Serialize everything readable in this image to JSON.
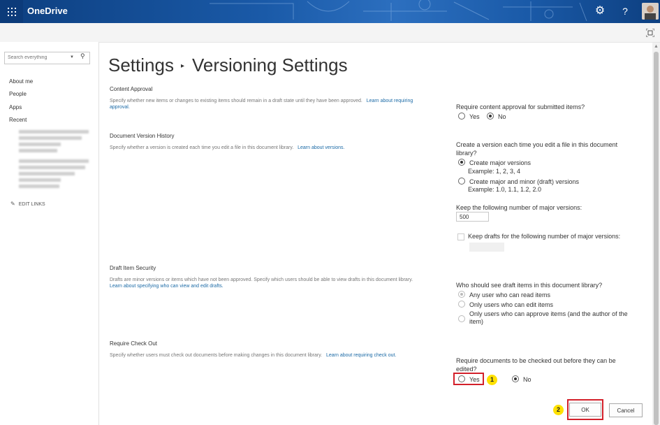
{
  "app": {
    "brand": "OneDrive"
  },
  "header": {
    "settings_icon": "gear-icon",
    "help_label": "?",
    "waffle_icon": "app-launcher-icon"
  },
  "search": {
    "placeholder": "Search everything"
  },
  "nav": {
    "items": [
      {
        "label": "About me"
      },
      {
        "label": "People"
      },
      {
        "label": "Apps"
      },
      {
        "label": "Recent"
      }
    ],
    "edit_links": "EDIT LINKS"
  },
  "page": {
    "title_part1": "Settings",
    "title_part2": "Versioning Settings"
  },
  "sections": {
    "content_approval": {
      "heading": "Content Approval",
      "desc": "Specify whether new items or changes to existing items should remain in a draft state until they have been approved.",
      "link": "Learn about requiring approval.",
      "question": "Require content approval for submitted items?",
      "options": [
        "Yes",
        "No"
      ],
      "selected": "No"
    },
    "version_history": {
      "heading": "Document Version History",
      "desc": "Specify whether a version is created each time you edit a file in this document library.",
      "link": "Learn about versions.",
      "question": "Create a version each time you edit a file in this document library?",
      "option_major": "Create major versions",
      "option_major_example": "Example: 1, 2, 3, 4",
      "option_minor": "Create major and minor (draft) versions",
      "option_minor_example": "Example: 1.0, 1.1, 1.2, 2.0",
      "selected": "Create major versions",
      "keep_major_label": "Keep the following number of major versions:",
      "keep_major_value": "500",
      "keep_drafts_label": "Keep drafts for the following number of major versions:"
    },
    "draft_security": {
      "heading": "Draft Item Security",
      "desc": "Drafts are minor versions or items which have not been approved. Specify which users should be able to view drafts in this document library.",
      "link": "Learn about specifying who can view and edit drafts.",
      "question": "Who should see draft items in this document library?",
      "options": [
        "Any user who can read items",
        "Only users who can edit items",
        "Only users who can approve items (and the author of the item)"
      ],
      "selected": "Any user who can read items"
    },
    "check_out": {
      "heading": "Require Check Out",
      "desc": "Specify whether users must check out documents before making changes in this document library.",
      "link": "Learn about requiring check out.",
      "question": "Require documents to be checked out before they can be edited?",
      "options": [
        "Yes",
        "No"
      ],
      "selected": "No"
    }
  },
  "annotations": {
    "step1": "1",
    "step2": "2",
    "highlight_color": "#d3202a",
    "badge_color": "#ffe100"
  },
  "buttons": {
    "ok": "OK",
    "cancel": "Cancel"
  }
}
